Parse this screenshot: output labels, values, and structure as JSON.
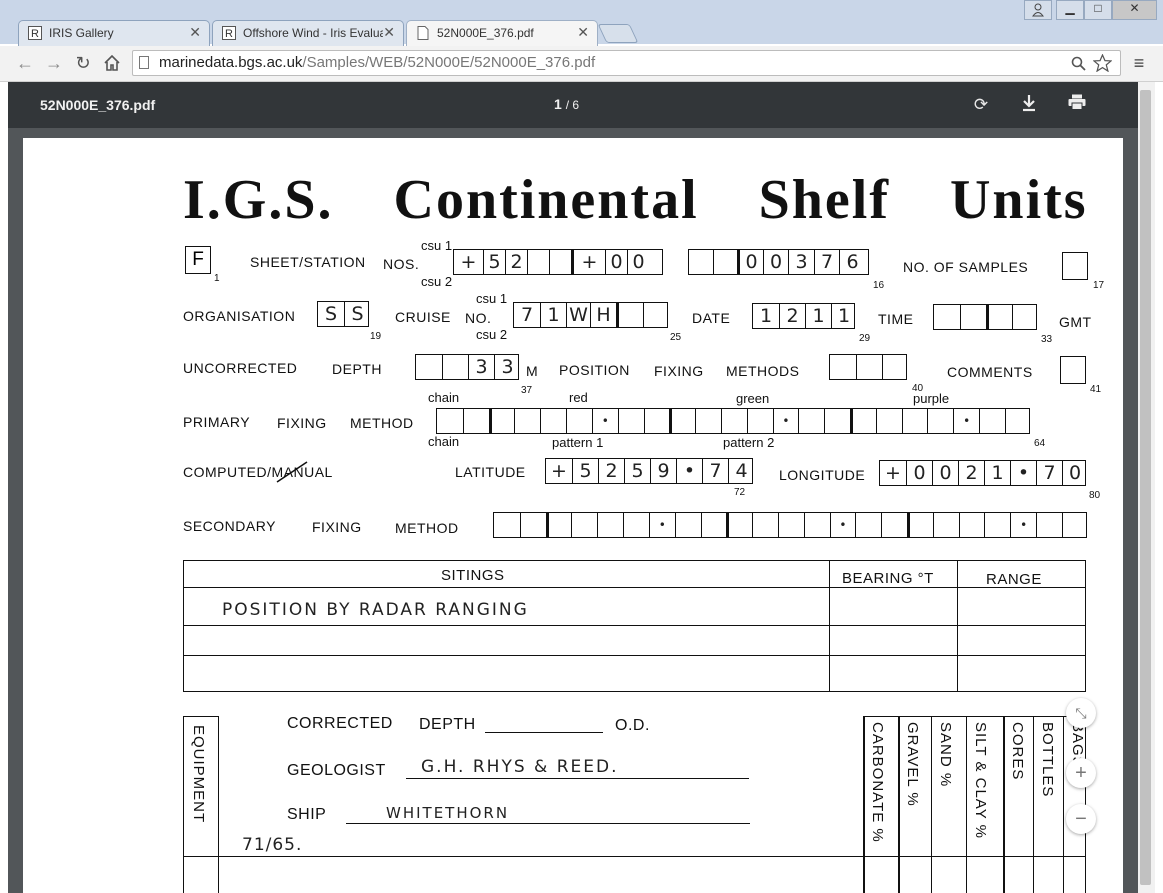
{
  "browser": {
    "tabs": [
      {
        "title": "IRIS Gallery",
        "active": false
      },
      {
        "title": "Offshore Wind - Iris Evalua",
        "active": false
      },
      {
        "title": "52N000E_376.pdf",
        "active": true
      }
    ],
    "address_host": "marinedata.bgs.ac.uk",
    "address_path": "/Samples/WEB/52N000E/52N000E_376.pdf",
    "icons": [
      "back-icon",
      "forward-icon",
      "reload-icon",
      "home-icon",
      "search-icon",
      "star-icon",
      "menu-icon",
      "user-icon",
      "minimize-icon",
      "maximize-icon",
      "close-icon"
    ]
  },
  "pdf_toolbar": {
    "filename": "52N000E_376.pdf",
    "current_page": "1",
    "total_pages": "/ 6",
    "icons": [
      "rotate-icon",
      "download-icon",
      "print-icon"
    ]
  },
  "form": {
    "title": "I.G.S.  Continental  Shelf  Units",
    "f_box": "F",
    "f_num": "1",
    "sheet_station_label": "SHEET/STATION",
    "nos_label": "NOS.",
    "csu1": "csu 1",
    "csu2": "csu 2",
    "station_cells_1": [
      "+",
      "5",
      "2",
      "",
      "",
      "+",
      "0",
      "0"
    ],
    "station_cells_2": [
      "",
      "",
      "0",
      "0",
      "3",
      "7",
      "6"
    ],
    "num_16": "16",
    "no_of_samples_label": "NO.  OF  SAMPLES",
    "num_17": "17",
    "organisation_label": "ORGANISATION",
    "organisation_cells": [
      "S",
      "S"
    ],
    "num_19": "19",
    "cruise_label": "CRUISE",
    "no_label": "NO.",
    "cruise_cells": [
      "7",
      "1",
      "W",
      "H",
      "",
      ""
    ],
    "num_25": "25",
    "date_label": "DATE",
    "date_cells": [
      "1",
      "2",
      "1",
      "1"
    ],
    "num_29": "29",
    "time_label": "TIME",
    "gmt_label": "GMT",
    "num_33": "33",
    "uncorrected_label": "UNCORRECTED",
    "depth_label": "DEPTH",
    "depth_cells": [
      "",
      "",
      "3",
      "3"
    ],
    "m_label": "M",
    "num_37": "37",
    "position_label": "POSITION",
    "fixing_label": "FIXING",
    "methods_label": "METHODS",
    "num_40": "40",
    "comments_label": "COMMENTS",
    "num_41": "41",
    "chain_label": "chain",
    "red_label": "red",
    "green_label": "green",
    "purple_label": "purple",
    "primary_label": "PRIMARY",
    "method_label": "METHOD",
    "pattern1_label": "pattern 1",
    "pattern2_label": "pattern 2",
    "num_64": "64",
    "computed_manual_label": "COMPUTED/MANUAL",
    "latitude_label": "LATITUDE",
    "latitude_cells": [
      "+",
      "5",
      "2",
      "5",
      "9",
      "•",
      "7",
      "4"
    ],
    "num_72": "72",
    "longitude_label": "LONGITUDE",
    "longitude_cells": [
      "+",
      "0",
      "0",
      "2",
      "1",
      "•",
      "7",
      "0"
    ],
    "num_80": "80",
    "secondary_label": "SECONDARY",
    "sitings_header": "SITINGS",
    "bearing_header": "BEARING °T",
    "range_header": "RANGE",
    "siting_row_1": "POSITION   BY   RADAR   RANGING",
    "corrected_label": "CORRECTED",
    "od_label": "O.D.",
    "geologist_label": "GEOLOGIST",
    "geologist_value": "G.H. RHYS & REED.",
    "ship_label": "SHIP",
    "ship_value": "WHITETHORN",
    "equipment_label": "EQUIPMENT",
    "ref_note": "71/65.",
    "columns": [
      "CARBONATE %",
      "GRAVEL %",
      "SAND %",
      "SILT & CLAY %",
      "CORES",
      "BOTTLES",
      "BAGS"
    ]
  }
}
